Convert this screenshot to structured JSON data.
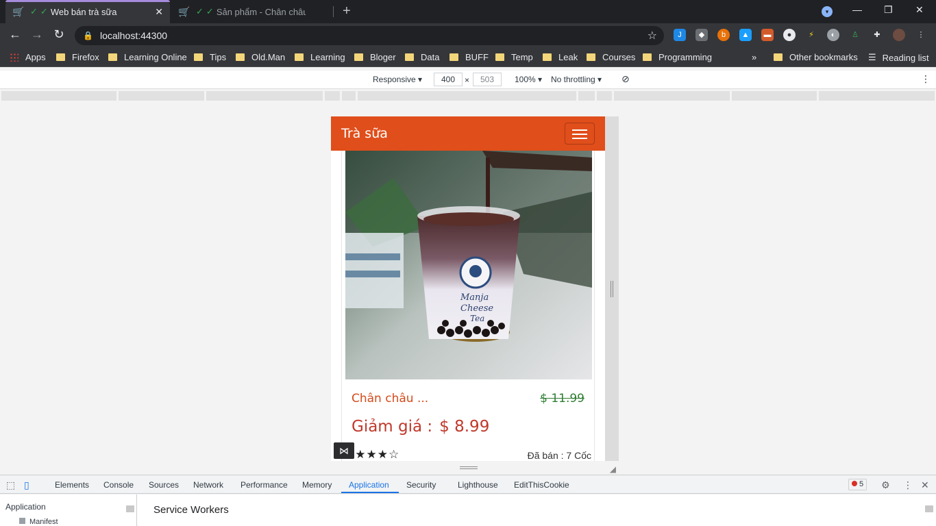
{
  "browser": {
    "tabs": [
      {
        "title": "Web bán trà sữa",
        "active": true
      },
      {
        "title": "Sản phẩm - Chân châu nư",
        "active": false
      }
    ],
    "address": "localhost:44300",
    "bookmarks": [
      "Apps",
      "Firefox",
      "Learning Online",
      "Tips",
      "Old.Man",
      "Learning",
      "Bloger",
      "Data",
      "BUFF",
      "Temp",
      "Leak",
      "Courses",
      "Programming"
    ],
    "other_bookmarks": "Other bookmarks",
    "reading_list": "Reading list"
  },
  "device_toolbar": {
    "mode": "Responsive",
    "width": "400",
    "height": "503",
    "zoom": "100%",
    "throttling": "No throttling"
  },
  "site": {
    "brand": "Trà sữa",
    "product": {
      "name": "Chân châu ...",
      "old_price": "$ 11.99",
      "sale_label": "Giảm giá :",
      "sale_price": "$ 8.99",
      "rating": 4,
      "rating_text": "★★★★☆",
      "sold": "Đã bán : 7 Cốc"
    }
  },
  "devtools": {
    "tabs": [
      "Elements",
      "Console",
      "Sources",
      "Network",
      "Performance",
      "Memory",
      "Application",
      "Security",
      "Lighthouse",
      "EditThisCookie"
    ],
    "active_tab": "Application",
    "error_count": "5",
    "sidebar_title": "Application",
    "sidebar_item": "Manifest",
    "main_title": "Service Workers"
  },
  "colors": {
    "navbar": "#e04e1b",
    "product_name": "#d54a1b",
    "old_price": "#2e7d32",
    "sale": "#c0392b"
  }
}
